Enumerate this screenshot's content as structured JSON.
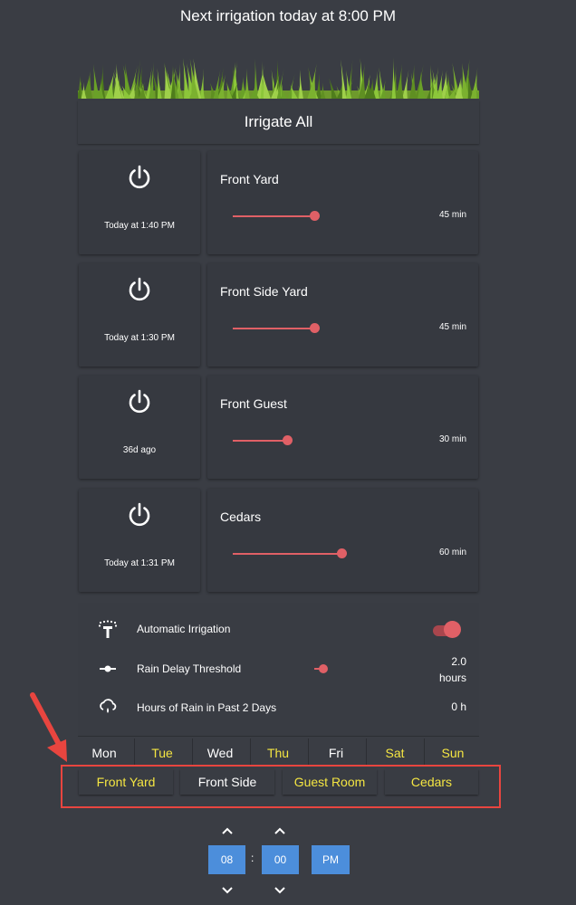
{
  "header": {
    "title": "Next irrigation today at 8:00 PM"
  },
  "irrigate_all": {
    "label": "Irrigate All"
  },
  "zones": [
    {
      "name": "Front Yard",
      "last_run": "Today at 1:40 PM",
      "duration": "45 min",
      "duration_minutes": 45
    },
    {
      "name": "Front Side Yard",
      "last_run": "Today at 1:30 PM",
      "duration": "45 min",
      "duration_minutes": 45
    },
    {
      "name": "Front Guest",
      "last_run": "36d ago",
      "duration": "30 min",
      "duration_minutes": 30
    },
    {
      "name": "Cedars",
      "last_run": "Today at 1:31 PM",
      "duration": "60 min",
      "duration_minutes": 60
    }
  ],
  "settings": {
    "automatic_irrigation": {
      "label": "Automatic Irrigation",
      "enabled": true
    },
    "rain_delay": {
      "label": "Rain Delay Threshold",
      "value_line1": "2.0",
      "value_line2": "hours"
    },
    "rain_hours": {
      "label": "Hours of Rain in Past 2 Days",
      "value": "0 h"
    }
  },
  "days": [
    {
      "label": "Mon",
      "active": false
    },
    {
      "label": "Tue",
      "active": true
    },
    {
      "label": "Wed",
      "active": false
    },
    {
      "label": "Thu",
      "active": true
    },
    {
      "label": "Fri",
      "active": false
    },
    {
      "label": "Sat",
      "active": true
    },
    {
      "label": "Sun",
      "active": true
    }
  ],
  "zone_buttons": [
    {
      "label": "Front Yard",
      "active": true
    },
    {
      "label": "Front Side",
      "active": false
    },
    {
      "label": "Guest Room",
      "active": true
    },
    {
      "label": "Cedars",
      "active": true
    }
  ],
  "time_picker": {
    "hour": "08",
    "minute": "00",
    "period": "PM",
    "separator": ":"
  },
  "colors": {
    "background": "#3a3d44",
    "card": "#363940",
    "accent": "#e06066",
    "active_text": "#f5e642",
    "time_box": "#4c8edb",
    "annotation": "#e8453f"
  }
}
